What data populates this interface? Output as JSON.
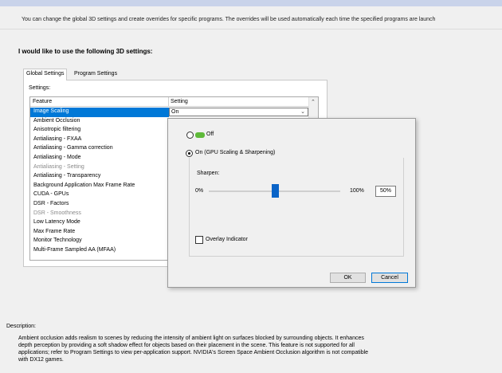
{
  "intro": {
    "text": "You can change the global 3D settings and create overrides for specific programs. The overrides will be used automatically each time the specified programs are launch"
  },
  "settings_heading": "I would like to use the following 3D settings:",
  "tabs": [
    {
      "label": "Global Settings",
      "active": true
    },
    {
      "label": "Program Settings",
      "active": false
    }
  ],
  "settings_label": "Settings:",
  "table": {
    "columns": [
      "Feature",
      "Setting"
    ],
    "rows": [
      {
        "feature": "Image Scaling",
        "setting": "On",
        "selected": true,
        "disabled": false
      },
      {
        "feature": "Ambient Occlusion",
        "selected": false,
        "disabled": false
      },
      {
        "feature": "Anisotropic filtering",
        "selected": false,
        "disabled": false
      },
      {
        "feature": "Antialiasing - FXAA",
        "selected": false,
        "disabled": false
      },
      {
        "feature": "Antialiasing - Gamma correction",
        "selected": false,
        "disabled": false
      },
      {
        "feature": "Antialiasing - Mode",
        "selected": false,
        "disabled": false
      },
      {
        "feature": "Antialiasing - Setting",
        "selected": false,
        "disabled": true
      },
      {
        "feature": "Antialiasing - Transparency",
        "selected": false,
        "disabled": false
      },
      {
        "feature": "Background Application Max Frame Rate",
        "selected": false,
        "disabled": false
      },
      {
        "feature": "CUDA - GPUs",
        "selected": false,
        "disabled": false
      },
      {
        "feature": "DSR - Factors",
        "selected": false,
        "disabled": false
      },
      {
        "feature": "DSR - Smoothness",
        "selected": false,
        "disabled": true
      },
      {
        "feature": "Low Latency Mode",
        "selected": false,
        "disabled": false
      },
      {
        "feature": "Max Frame Rate",
        "selected": false,
        "disabled": false
      },
      {
        "feature": "Monitor Technology",
        "selected": false,
        "disabled": false
      },
      {
        "feature": "Multi-Frame Sampled AA (MFAA)",
        "selected": false,
        "disabled": false
      }
    ]
  },
  "popup": {
    "off_label": "Off",
    "on_label": "On (GPU Scaling & Sharpening)",
    "selected_option": "on",
    "sharpen_label": "Sharpen:",
    "min_label": "0%",
    "max_label": "100%",
    "sharpen_value": "50%",
    "sharpen_fraction": 0.5,
    "overlay_label": "Overlay Indicator",
    "overlay_checked": false,
    "ok_label": "OK",
    "cancel_label": "Cancel"
  },
  "description": {
    "label": "Description:",
    "text": "Ambient occlusion adds realism to scenes by reducing the intensity of ambient light on surfaces blocked by surrounding objects. It enhances depth perception by providing a soft shadow effect for objects based on their placement in the scene. This feature is not supported for all applications; refer to Program Settings to view per-application support. NVIDIA's Screen Space Ambient Occlusion algorithm is not compatible with DX12 games."
  },
  "colors": {
    "selection": "#0078d7",
    "slider_thumb": "#0a64c8",
    "toggle_green": "#5fba3a"
  },
  "icons": [
    "dropdown-arrow-icon",
    "scroll-up-icon",
    "toggle-icon"
  ]
}
